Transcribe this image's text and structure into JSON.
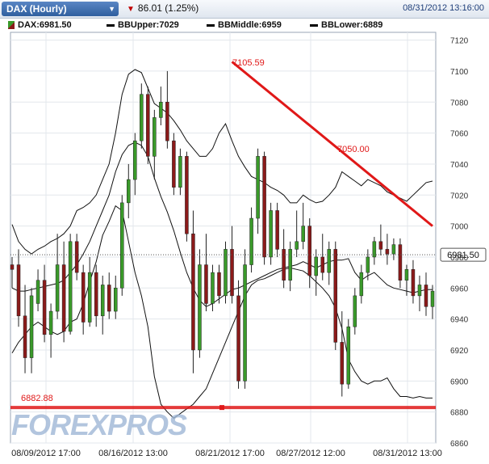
{
  "header": {
    "symbol_tab": "DAX (Hourly)",
    "change": "86.01 (1.25%)",
    "datetime": "08/31/2012 13:16:00"
  },
  "legend": {
    "main": "DAX:6981.50",
    "upper": "BBUpper:7029",
    "middle": "BBMiddle:6959",
    "lower": "BBLower:6889"
  },
  "logo": "FOREXPROS",
  "colors": {
    "up": "#3a9a2a",
    "down": "#8b1a1a",
    "trend": "#e01818",
    "accent": "#1f3f7a"
  },
  "chart_data": {
    "type": "candlestick",
    "ylim": [
      6860,
      7125
    ],
    "y_ticks": [
      6860,
      6880,
      6900,
      6920,
      6940,
      6960,
      6980,
      7000,
      7020,
      7040,
      7060,
      7080,
      7100,
      7120
    ],
    "x_tick_labels": [
      "08/09/2012 17:00",
      "08/16/2012 13:00",
      "08/21/2012 17:00",
      "08/27/2012 12:00",
      "08/31/2012 13:00"
    ],
    "last_price": "6981.50",
    "annotations": [
      {
        "label": "7105.59",
        "value": 7105.59
      },
      {
        "label": "7050.00",
        "value": 7050.0
      },
      {
        "label": "6882.88",
        "value": 6882.88
      }
    ],
    "support_level": 6882.88,
    "trendline": [
      {
        "i": 34,
        "y": 7106
      },
      {
        "i": 65,
        "y": 7000
      }
    ],
    "candles": [
      [
        6975,
        6980,
        6960,
        6972
      ],
      [
        6975,
        6985,
        6935,
        6942
      ],
      [
        6942,
        6962,
        6905,
        6915
      ],
      [
        6915,
        6960,
        6905,
        6955
      ],
      [
        6950,
        6972,
        6945,
        6965
      ],
      [
        6965,
        6975,
        6925,
        6930
      ],
      [
        6930,
        6950,
        6915,
        6945
      ],
      [
        6945,
        6995,
        6940,
        6975
      ],
      [
        6975,
        6990,
        6925,
        6932
      ],
      [
        6932,
        6995,
        6930,
        6990
      ],
      [
        6990,
        6995,
        6965,
        6970
      ],
      [
        6970,
        6975,
        6930,
        6938
      ],
      [
        6938,
        6980,
        6935,
        6970
      ],
      [
        6970,
        6975,
        6935,
        6942
      ],
      [
        6942,
        6968,
        6930,
        6962
      ],
      [
        6962,
        6970,
        6940,
        6945
      ],
      [
        6945,
        6968,
        6940,
        6960
      ],
      [
        6960,
        7020,
        6955,
        7015
      ],
      [
        7015,
        7040,
        7005,
        7030
      ],
      [
        7030,
        7060,
        7020,
        7055
      ],
      [
        7055,
        7092,
        7050,
        7085
      ],
      [
        7085,
        7090,
        7040,
        7045
      ],
      [
        7045,
        7075,
        7030,
        7070
      ],
      [
        7070,
        7090,
        7065,
        7080
      ],
      [
        7080,
        7100,
        7050,
        7055
      ],
      [
        7055,
        7060,
        7020,
        7025
      ],
      [
        7025,
        7050,
        7020,
        7045
      ],
      [
        7045,
        7048,
        6990,
        6995
      ],
      [
        6995,
        7010,
        6905,
        6920
      ],
      [
        6920,
        6985,
        6915,
        6975
      ],
      [
        6975,
        6995,
        6945,
        6950
      ],
      [
        6950,
        6975,
        6945,
        6970
      ],
      [
        6970,
        6975,
        6950,
        6955
      ],
      [
        6955,
        6990,
        6950,
        6985
      ],
      [
        6985,
        7000,
        6950,
        6955
      ],
      [
        6955,
        6965,
        6895,
        6900
      ],
      [
        6900,
        6985,
        6895,
        6975
      ],
      [
        6975,
        7012,
        6970,
        7005
      ],
      [
        7005,
        7050,
        6995,
        7045
      ],
      [
        7045,
        7048,
        6975,
        6980
      ],
      [
        6980,
        7015,
        6975,
        7010
      ],
      [
        7010,
        7015,
        6980,
        6985
      ],
      [
        6985,
        6998,
        6960,
        6965
      ],
      [
        6965,
        6990,
        6958,
        6985
      ],
      [
        6985,
        7010,
        6980,
        6990
      ],
      [
        6990,
        7015,
        6985,
        7000
      ],
      [
        7000,
        7005,
        6960,
        6968
      ],
      [
        6968,
        6985,
        6955,
        6980
      ],
      [
        6980,
        6995,
        6965,
        6970
      ],
      [
        6970,
        6990,
        6962,
        6985
      ],
      [
        6985,
        6990,
        6920,
        6925
      ],
      [
        6925,
        6945,
        6890,
        6898
      ],
      [
        6898,
        6940,
        6895,
        6935
      ],
      [
        6935,
        6960,
        6930,
        6955
      ],
      [
        6955,
        6975,
        6950,
        6970
      ],
      [
        6970,
        6985,
        6965,
        6980
      ],
      [
        6980,
        6993,
        6975,
        6990
      ],
      [
        6990,
        7001,
        6981,
        6985
      ],
      [
        6985,
        6995,
        6975,
        6982
      ],
      [
        6982,
        6992,
        6978,
        6988
      ],
      [
        6988,
        6992,
        6960,
        6965
      ],
      [
        6965,
        6975,
        6955,
        6972
      ],
      [
        6972,
        6978,
        6950,
        6955
      ],
      [
        6955,
        6968,
        6945,
        6962
      ],
      [
        6962,
        6970,
        6942,
        6948
      ],
      [
        6948,
        6962,
        6940,
        6958
      ]
    ],
    "bands": {
      "upper": [
        7001,
        6990,
        6985,
        6982,
        6985,
        6987,
        6990,
        6992,
        6995,
        7000,
        7010,
        7012,
        7015,
        7020,
        7030,
        7040,
        7060,
        7085,
        7098,
        7101,
        7099,
        7089,
        7079,
        7076,
        7073,
        7068,
        7062,
        7055,
        7050,
        7045,
        7045,
        7050,
        7060,
        7066,
        7055,
        7045,
        7038,
        7032,
        7030,
        7028,
        7025,
        7023,
        7020,
        7015,
        7015,
        7020,
        7017,
        7015,
        7016,
        7020,
        7025,
        7035,
        7032,
        7029,
        7026,
        7030,
        7028,
        7026,
        7022,
        7020,
        7018,
        7016,
        7020,
        7024,
        7028,
        7029
      ],
      "middle": [
        6960,
        6958,
        6958,
        6959,
        6960,
        6961,
        6962,
        6963,
        6965,
        6970,
        6975,
        6982,
        6990,
        7000,
        7010,
        7020,
        7035,
        7046,
        7052,
        7054,
        7052,
        7045,
        7031,
        7019,
        7009,
        6997,
        6983,
        6970,
        6960,
        6952,
        6948,
        6950,
        6953,
        6956,
        6959,
        6960,
        6962,
        6964,
        6966,
        6968,
        6970,
        6972,
        6973,
        6974,
        6975,
        6977,
        6975,
        6973,
        6975,
        6977,
        6978,
        6978,
        6979,
        6970,
        6965,
        6968,
        6970,
        6966,
        6962,
        6960,
        6959,
        6958,
        6957,
        6958,
        6959,
        6959
      ],
      "lower": [
        6918,
        6925,
        6930,
        6935,
        6938,
        6935,
        6932,
        6930,
        6932,
        6938,
        6940,
        6950,
        6964,
        6977,
        6994,
        7003,
        7013,
        7010,
        6990,
        6970,
        6955,
        6935,
        6903,
        6885,
        6880,
        6876,
        6879,
        6882,
        6885,
        6890,
        6895,
        6905,
        6915,
        6925,
        6935,
        6945,
        6955,
        6962,
        6965,
        6966,
        6968,
        6970,
        6972,
        6973,
        6972,
        6971,
        6968,
        6964,
        6960,
        6955,
        6947,
        6934,
        6914,
        6906,
        6900,
        6898,
        6900,
        6900,
        6902,
        6895,
        6890,
        6890,
        6889,
        6890,
        6889,
        6889
      ]
    }
  }
}
